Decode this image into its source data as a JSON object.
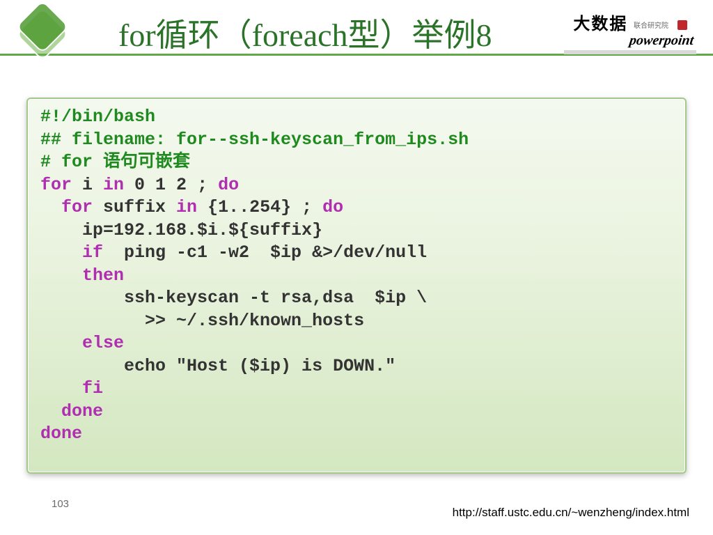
{
  "title": "for循环（foreach型）举例8",
  "badge": {
    "line1_main": "大数据",
    "line1_sub": "联合研究院",
    "line2": "powerpoint"
  },
  "code": {
    "l1": "#!/bin/bash",
    "l2": "## filename: for--ssh-keyscan_from_ips.sh",
    "l3a": "# ",
    "l3b": "for",
    "l3c": " 语句可嵌套",
    "l4a": "for",
    "l4b": " i ",
    "l4c": "in",
    "l4d": " 0 1 2 ; ",
    "l4e": "do",
    "l5a": "  for",
    "l5b": " suffix ",
    "l5c": "in",
    "l5d": " {1..254} ; ",
    "l5e": "do",
    "l6": "    ip=192.168.$i.${suffix}",
    "l7a": "    if",
    "l7b": "  ping -c1 -w2  $ip &>/dev/null",
    "l8": "    then",
    "l9": "        ssh-keyscan -t rsa,dsa  $ip \\",
    "l10": "          >> ~/.ssh/known_hosts",
    "l11": "    else",
    "l12": "        echo \"Host ($ip) is DOWN.\"",
    "l13": "    fi",
    "l14": "  done",
    "l15": "done"
  },
  "page_number": "103",
  "footer_url": "http://staff.ustc.edu.cn/~wenzheng/index.html"
}
